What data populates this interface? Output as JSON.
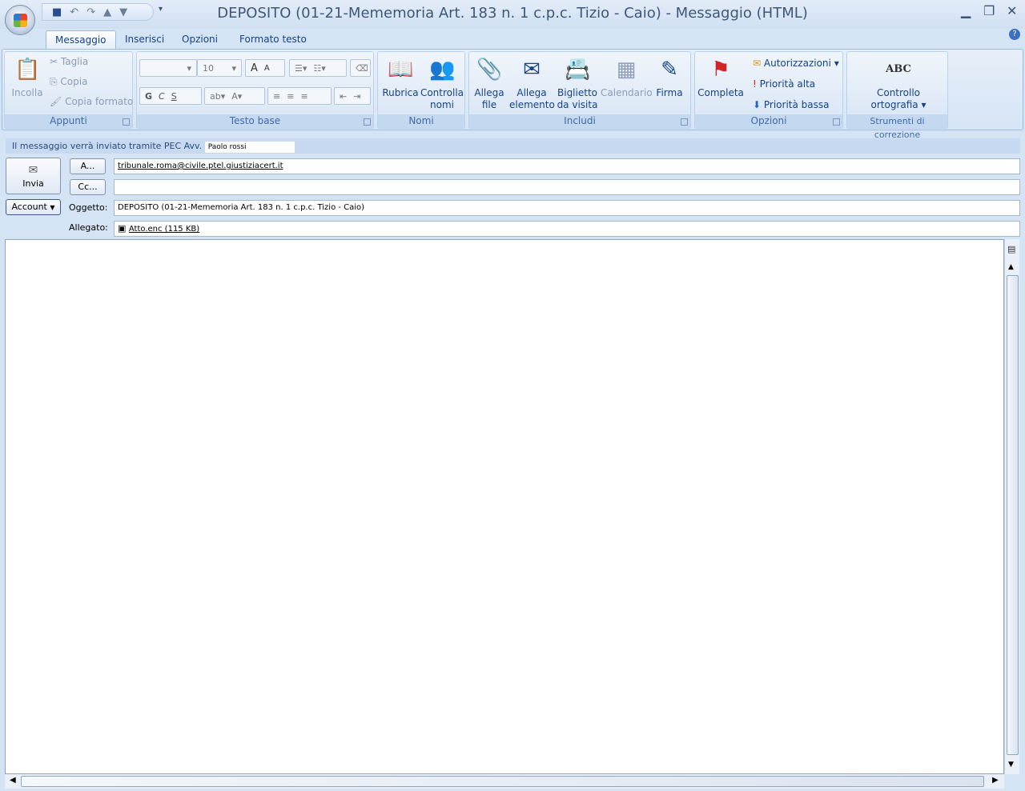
{
  "window": {
    "title": "DEPOSITO (01-21-Mememoria Art. 183 n. 1 c.p.c. Tizio - Caio) - Messaggio (HTML)"
  },
  "tabs": [
    {
      "label": "Messaggio"
    },
    {
      "label": "Inserisci"
    },
    {
      "label": "Opzioni"
    },
    {
      "label": "Formato testo"
    }
  ],
  "ribbon": {
    "appunti": {
      "label": "Appunti",
      "incolla": "Incolla",
      "taglia": "Taglia",
      "copia": "Copia",
      "copia_formato": "Copia formato"
    },
    "testo_base": {
      "label": "Testo base",
      "font_size": "10",
      "bold": "G",
      "italic": "C",
      "underline": "S",
      "grow": "A",
      "shrink": "A"
    },
    "nomi": {
      "label": "Nomi",
      "rubrica": "Rubrica",
      "controlla": "Controlla nomi"
    },
    "includi": {
      "label": "Includi",
      "allega_file": "Allega file",
      "allega_elemento": "Allega elemento",
      "biglietto": "Biglietto da visita",
      "calendario": "Calendario",
      "firma": "Firma"
    },
    "opzioni": {
      "label": "Opzioni",
      "completa": "Completa",
      "autorizzazioni": "Autorizzazioni",
      "alta": "Priorità alta",
      "bassa": "Priorità bassa"
    },
    "correzione": {
      "label": "Strumenti di correzione",
      "controllo": "Controllo ortografia",
      "abc": "ABC"
    }
  },
  "info": {
    "text": "Il messaggio verrà inviato tramite PEC Avv.",
    "sender": "Paolo rossi"
  },
  "compose": {
    "send": "Invia",
    "to_btn": "A...",
    "cc_btn": "Cc...",
    "account": "Account",
    "subject_label": "Oggetto:",
    "attach_label": "Allegato:",
    "to": "tribunale.roma@civile.ptel.giustiziacert.it",
    "cc": "",
    "subject": "DEPOSITO (01-21-Mememoria Art. 183 n. 1 c.p.c. Tizio - Caio)",
    "attachment": "Atto.enc (115 KB)"
  }
}
